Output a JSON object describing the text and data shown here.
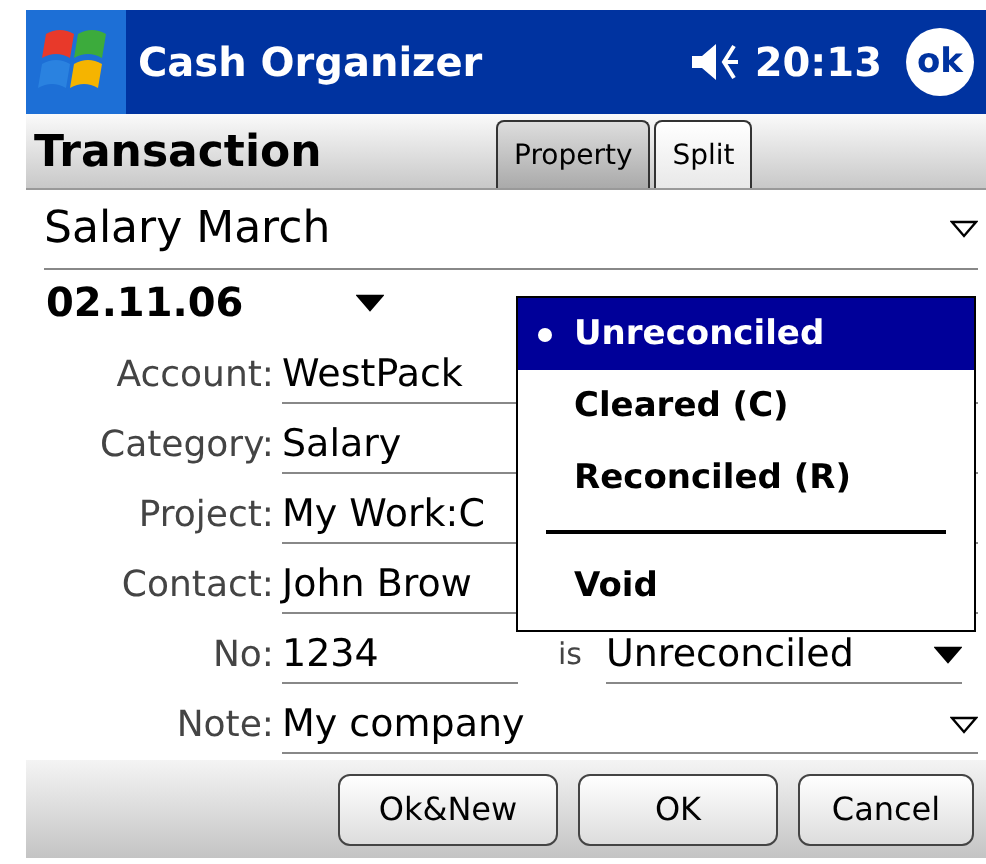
{
  "title_bar": {
    "title": "Cash Organizer",
    "time": "20:13",
    "ok": "ok"
  },
  "header": {
    "title": "Transaction",
    "tabs": [
      {
        "label": "Property",
        "selected": true
      },
      {
        "label": "Split",
        "selected": false
      }
    ]
  },
  "description": {
    "value": "Salary March"
  },
  "date": {
    "value": "02.11.06"
  },
  "fields": [
    {
      "label": "Account:",
      "value": "WestPack"
    },
    {
      "label": "Category:",
      "value": "Salary"
    },
    {
      "label": "Project:",
      "value": "My Work:C"
    },
    {
      "label": "Contact:",
      "value": "John Brow"
    }
  ],
  "number": {
    "label": "No:",
    "value": "1234",
    "connector": "is",
    "status": "Unreconciled"
  },
  "note": {
    "label": "Note:",
    "value": "My company"
  },
  "status_menu": [
    {
      "kind": "option",
      "label": "Unreconciled",
      "selected": true
    },
    {
      "kind": "option",
      "label": "Cleared (C)",
      "selected": false
    },
    {
      "kind": "option",
      "label": "Reconciled (R)",
      "selected": false
    },
    {
      "kind": "separator"
    },
    {
      "kind": "option",
      "label": "Void",
      "selected": false
    }
  ],
  "buttons": [
    "Ok&New",
    "OK",
    "Cancel"
  ]
}
